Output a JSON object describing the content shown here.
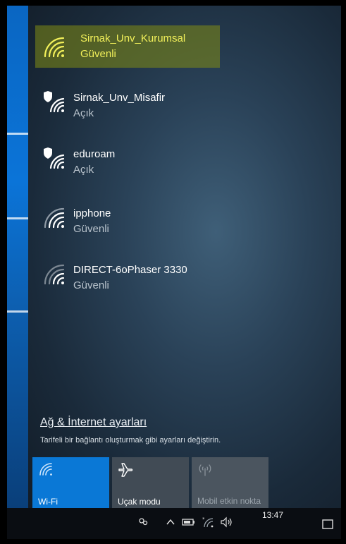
{
  "networks": [
    {
      "name": "Sirnak_Unv_Kurumsal",
      "status": "Güvenli",
      "icon": "wifi-icon",
      "selected": true
    },
    {
      "name": "Sirnak_Unv_Misafir",
      "status": "Açık",
      "icon": "wifi-shield-icon",
      "selected": false
    },
    {
      "name": "eduroam",
      "status": "Açık",
      "icon": "wifi-shield-icon",
      "selected": false
    },
    {
      "name": "ipphone",
      "status": "Güvenli",
      "icon": "wifi-icon",
      "selected": false
    },
    {
      "name": "DIRECT-6oPhaser 3330",
      "status": "Güvenli",
      "icon": "wifi-weak-icon",
      "selected": false
    }
  ],
  "settings": {
    "link": "Ağ & İnternet ayarları",
    "subtext": "Tarifeli bir bağlantı oluşturmak gibi ayarları değiştirin."
  },
  "quick_actions": {
    "wifi": {
      "label": "Wi-Fi",
      "state": "on"
    },
    "airplane": {
      "label": "Uçak modu",
      "state": "off"
    },
    "hotspot": {
      "label": "Mobil etkin nokta",
      "state": "disabled"
    }
  },
  "taskbar": {
    "clock": "13:47"
  },
  "colors": {
    "accent": "#0a78d6",
    "highlight": "#f2f05a"
  }
}
